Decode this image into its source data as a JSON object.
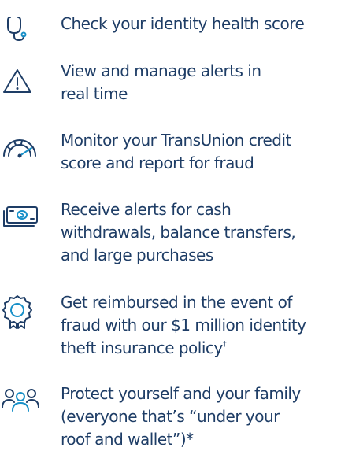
{
  "features": [
    {
      "icon": "stethoscope-icon",
      "lines": [
        "Check your identity health score"
      ]
    },
    {
      "icon": "warning-icon",
      "lines": [
        "View and manage alerts in",
        "real time"
      ]
    },
    {
      "icon": "speedometer-icon",
      "lines": [
        "Monitor your TransUnion credit",
        "score and report for fraud"
      ]
    },
    {
      "icon": "cash-icon",
      "lines": [
        "Receive alerts for cash",
        "withdrawals, balance transfers,",
        "and large purchases"
      ]
    },
    {
      "icon": "award-ribbon-icon",
      "lines": [
        "Get reimbursed in the event of",
        "fraud with our $1 million identity",
        "theft insurance policy"
      ],
      "footnote_mark": "†"
    },
    {
      "icon": "family-icon",
      "lines": [
        "Protect yourself and your family",
        "(everyone that’s “under your",
        "roof and wallet”)*"
      ]
    }
  ],
  "colors": {
    "text": "#1e3d66",
    "icon_stroke": "#1e3d66",
    "icon_accent": "#1890c8"
  }
}
